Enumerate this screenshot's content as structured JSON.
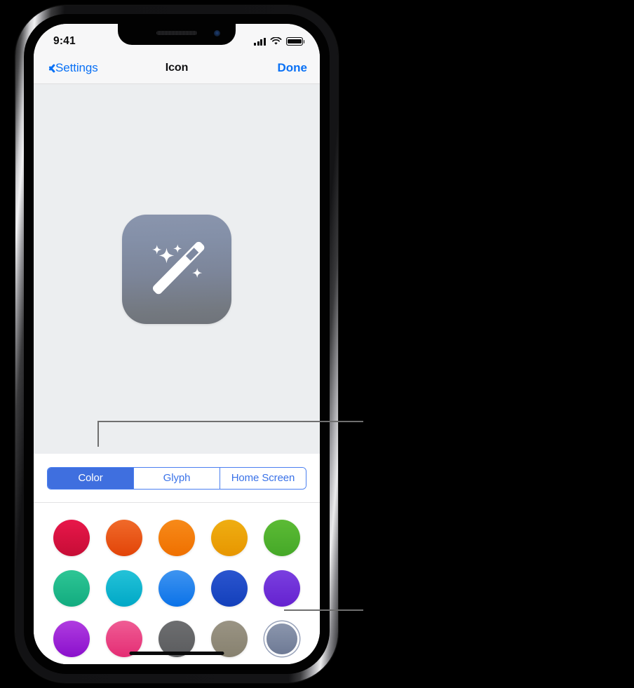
{
  "status_bar": {
    "time": "9:41",
    "signal_icon": "cellular-signal-icon",
    "wifi_icon": "wifi-icon",
    "battery_icon": "battery-icon"
  },
  "nav_bar": {
    "back_icon": "chevron-left-icon",
    "back_label": "Settings",
    "title": "Icon",
    "done_label": "Done"
  },
  "preview": {
    "icon_name": "magic-wand-sparkles-icon",
    "icon_gradient_top": "#8a95ad",
    "icon_gradient_bottom": "#6f737a"
  },
  "segmented_control": {
    "selected": "Color",
    "accent": "#3f6fdf",
    "options": [
      {
        "label": "Color",
        "selected": true
      },
      {
        "label": "Glyph",
        "selected": false
      },
      {
        "label": "Home Screen",
        "selected": false
      }
    ]
  },
  "color_grid": {
    "rows": [
      [
        {
          "name": "crimson",
          "top": "#e8174a",
          "bottom": "#c60d36",
          "selected": false
        },
        {
          "name": "red-orange",
          "top": "#f06a2a",
          "bottom": "#e24408",
          "selected": false
        },
        {
          "name": "orange",
          "top": "#f78a19",
          "bottom": "#ef7000",
          "selected": false
        },
        {
          "name": "amber",
          "top": "#efae12",
          "bottom": "#e79600",
          "selected": false
        },
        {
          "name": "green",
          "top": "#5cbb35",
          "bottom": "#45a828",
          "selected": false
        }
      ],
      [
        {
          "name": "teal-green",
          "top": "#2ec695",
          "bottom": "#12ab7f",
          "selected": false
        },
        {
          "name": "cyan",
          "top": "#24c2d8",
          "bottom": "#00a8c6",
          "selected": false
        },
        {
          "name": "light-blue",
          "top": "#3f94f0",
          "bottom": "#0b72e8",
          "selected": false
        },
        {
          "name": "deep-blue",
          "top": "#2b55cf",
          "bottom": "#1340bb",
          "selected": false
        },
        {
          "name": "purple",
          "top": "#7a3fe0",
          "bottom": "#6522cf",
          "selected": false
        }
      ],
      [
        {
          "name": "magenta",
          "top": "#b03ce0",
          "bottom": "#8a10cc",
          "selected": false
        },
        {
          "name": "pink",
          "top": "#ef5c94",
          "bottom": "#e42d74",
          "selected": false
        },
        {
          "name": "dark-gray",
          "top": "#6d6e70",
          "bottom": "#5b5c5e",
          "selected": false
        },
        {
          "name": "taupe",
          "top": "#9a9484",
          "bottom": "#87816f",
          "selected": false
        },
        {
          "name": "slate-blue",
          "top": "#8b96ad",
          "bottom": "#6e7a95",
          "selected": true
        }
      ]
    ]
  },
  "home_indicator": {
    "name": "home-indicator"
  },
  "callouts": [
    {
      "name": "callout-segmented-control"
    },
    {
      "name": "callout-selected-color"
    }
  ]
}
